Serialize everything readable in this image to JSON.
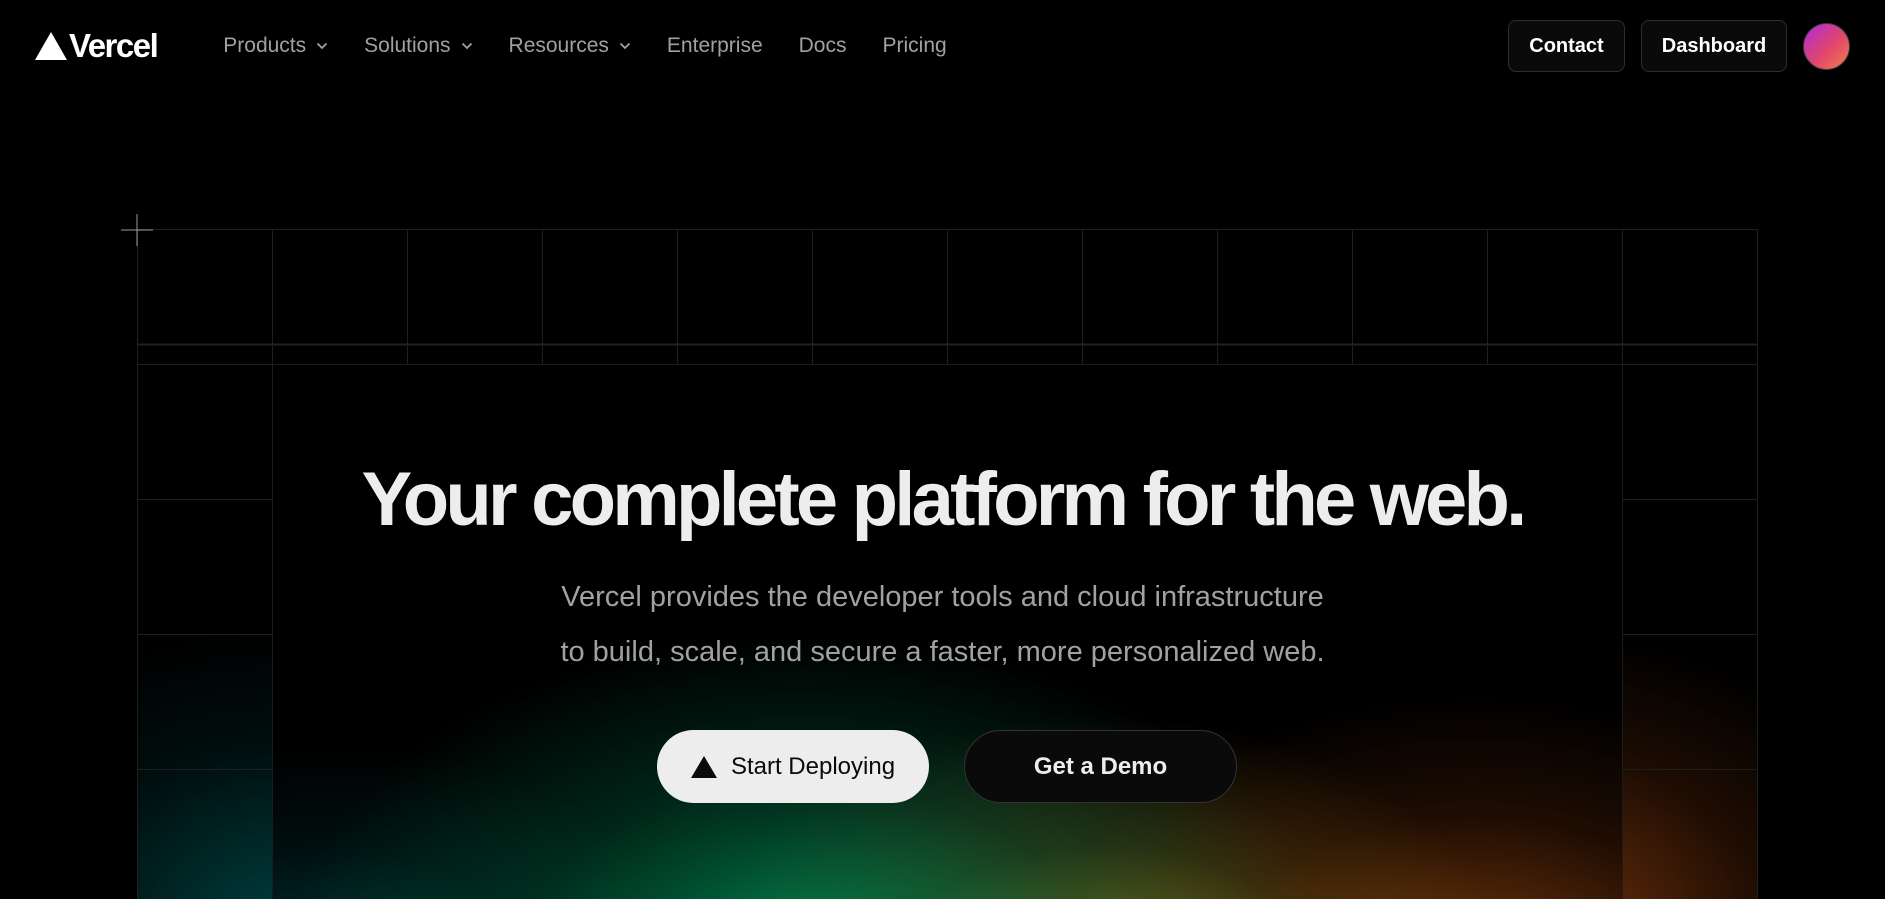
{
  "header": {
    "logo_text": "Vercel",
    "nav": [
      {
        "label": "Products",
        "has_menu": true
      },
      {
        "label": "Solutions",
        "has_menu": true
      },
      {
        "label": "Resources",
        "has_menu": true
      },
      {
        "label": "Enterprise",
        "has_menu": false
      },
      {
        "label": "Docs",
        "has_menu": false
      },
      {
        "label": "Pricing",
        "has_menu": false
      }
    ],
    "contact_label": "Contact",
    "dashboard_label": "Dashboard"
  },
  "hero": {
    "headline": "Your complete platform for the web.",
    "subline_1": "Vercel provides the developer tools and cloud infrastructure",
    "subline_2": "to build, scale, and secure a faster, more personalized web.",
    "primary_cta": "Start Deploying",
    "secondary_cta": "Get a Demo"
  },
  "icons": {
    "logo": "triangle-logo-icon",
    "nav_chevron": "chevron-down-icon",
    "cta_icon": "triangle-icon",
    "corner": "crosshair-icon"
  },
  "colors": {
    "background": "#000000",
    "text": "#ededed",
    "muted": "#a1a1a1",
    "primary_button": "#ededed"
  }
}
